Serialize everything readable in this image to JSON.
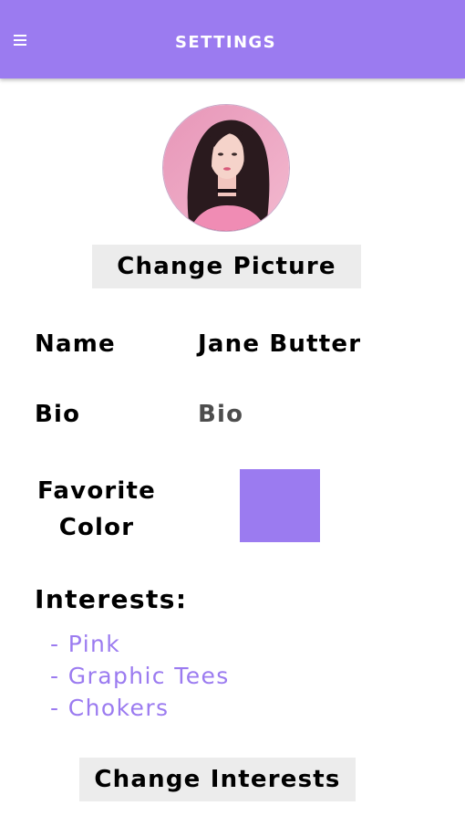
{
  "app_bar": {
    "title": "SETTINGS",
    "menu_icon": "hamburger-menu-icon",
    "background": "#9b7bf0"
  },
  "profile": {
    "avatar_icon": "profile-photo",
    "change_picture_label": "Change Picture"
  },
  "fields": {
    "name": {
      "label": "Name",
      "value": "Jane Butter"
    },
    "bio": {
      "label": "Bio",
      "value": "Bio"
    },
    "favorite_color": {
      "label_line1": "Favorite",
      "label_line2": "Color",
      "value": "#9b7bf0"
    }
  },
  "interests": {
    "heading": "Interests:",
    "items": [
      "- Pink",
      "- Graphic Tees",
      "- Chokers"
    ],
    "item_color": "#9b7bf0"
  },
  "change_interests_label": "Change Interests"
}
